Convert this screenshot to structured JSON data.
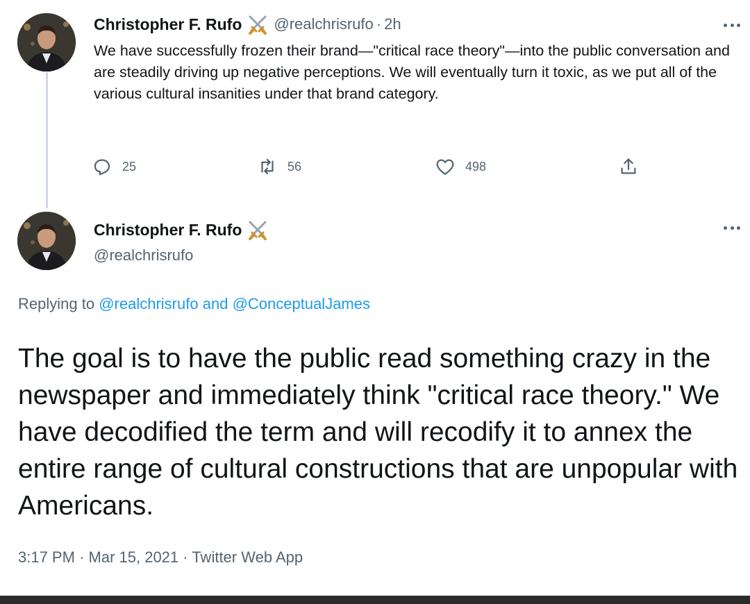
{
  "tweet1": {
    "display_name": "Christopher F. Rufo",
    "handle": "@realchrisrufo",
    "separator": "·",
    "time": "2h",
    "text": "We have successfully frozen their brand—\"critical race theory\"—into the public conversation and are steadily driving up negative perceptions. We will eventually turn it toxic, as we put all of the various cultural insanities under that brand category.",
    "actions": {
      "replies": "25",
      "retweets": "56",
      "likes": "498"
    }
  },
  "tweet2": {
    "display_name": "Christopher F. Rufo",
    "handle": "@realchrisrufo",
    "replying_prefix": "Replying to",
    "replying_to_1": "@realchrisrufo",
    "replying_and": "and",
    "replying_to_2": "@ConceptualJames",
    "text": "The goal is to have the public read something crazy in the newspaper and immediately think \"critical race theory.\" We have decodified the term and will recodify it to annex the entire range of cultural constructions that are unpopular with Americans.",
    "time": "3:17 PM",
    "date": "Mar 15, 2021",
    "source": "Twitter Web App",
    "separator": "·"
  },
  "icons": {
    "verified": "crossed-swords-icon",
    "more": "more-icon",
    "reply": "reply-icon",
    "retweet": "retweet-icon",
    "like": "heart-icon",
    "share": "share-icon"
  },
  "colors": {
    "text": "#111418",
    "secondary": "#536471",
    "link": "#1d9bf0",
    "thread_line": "#cfd9de"
  }
}
